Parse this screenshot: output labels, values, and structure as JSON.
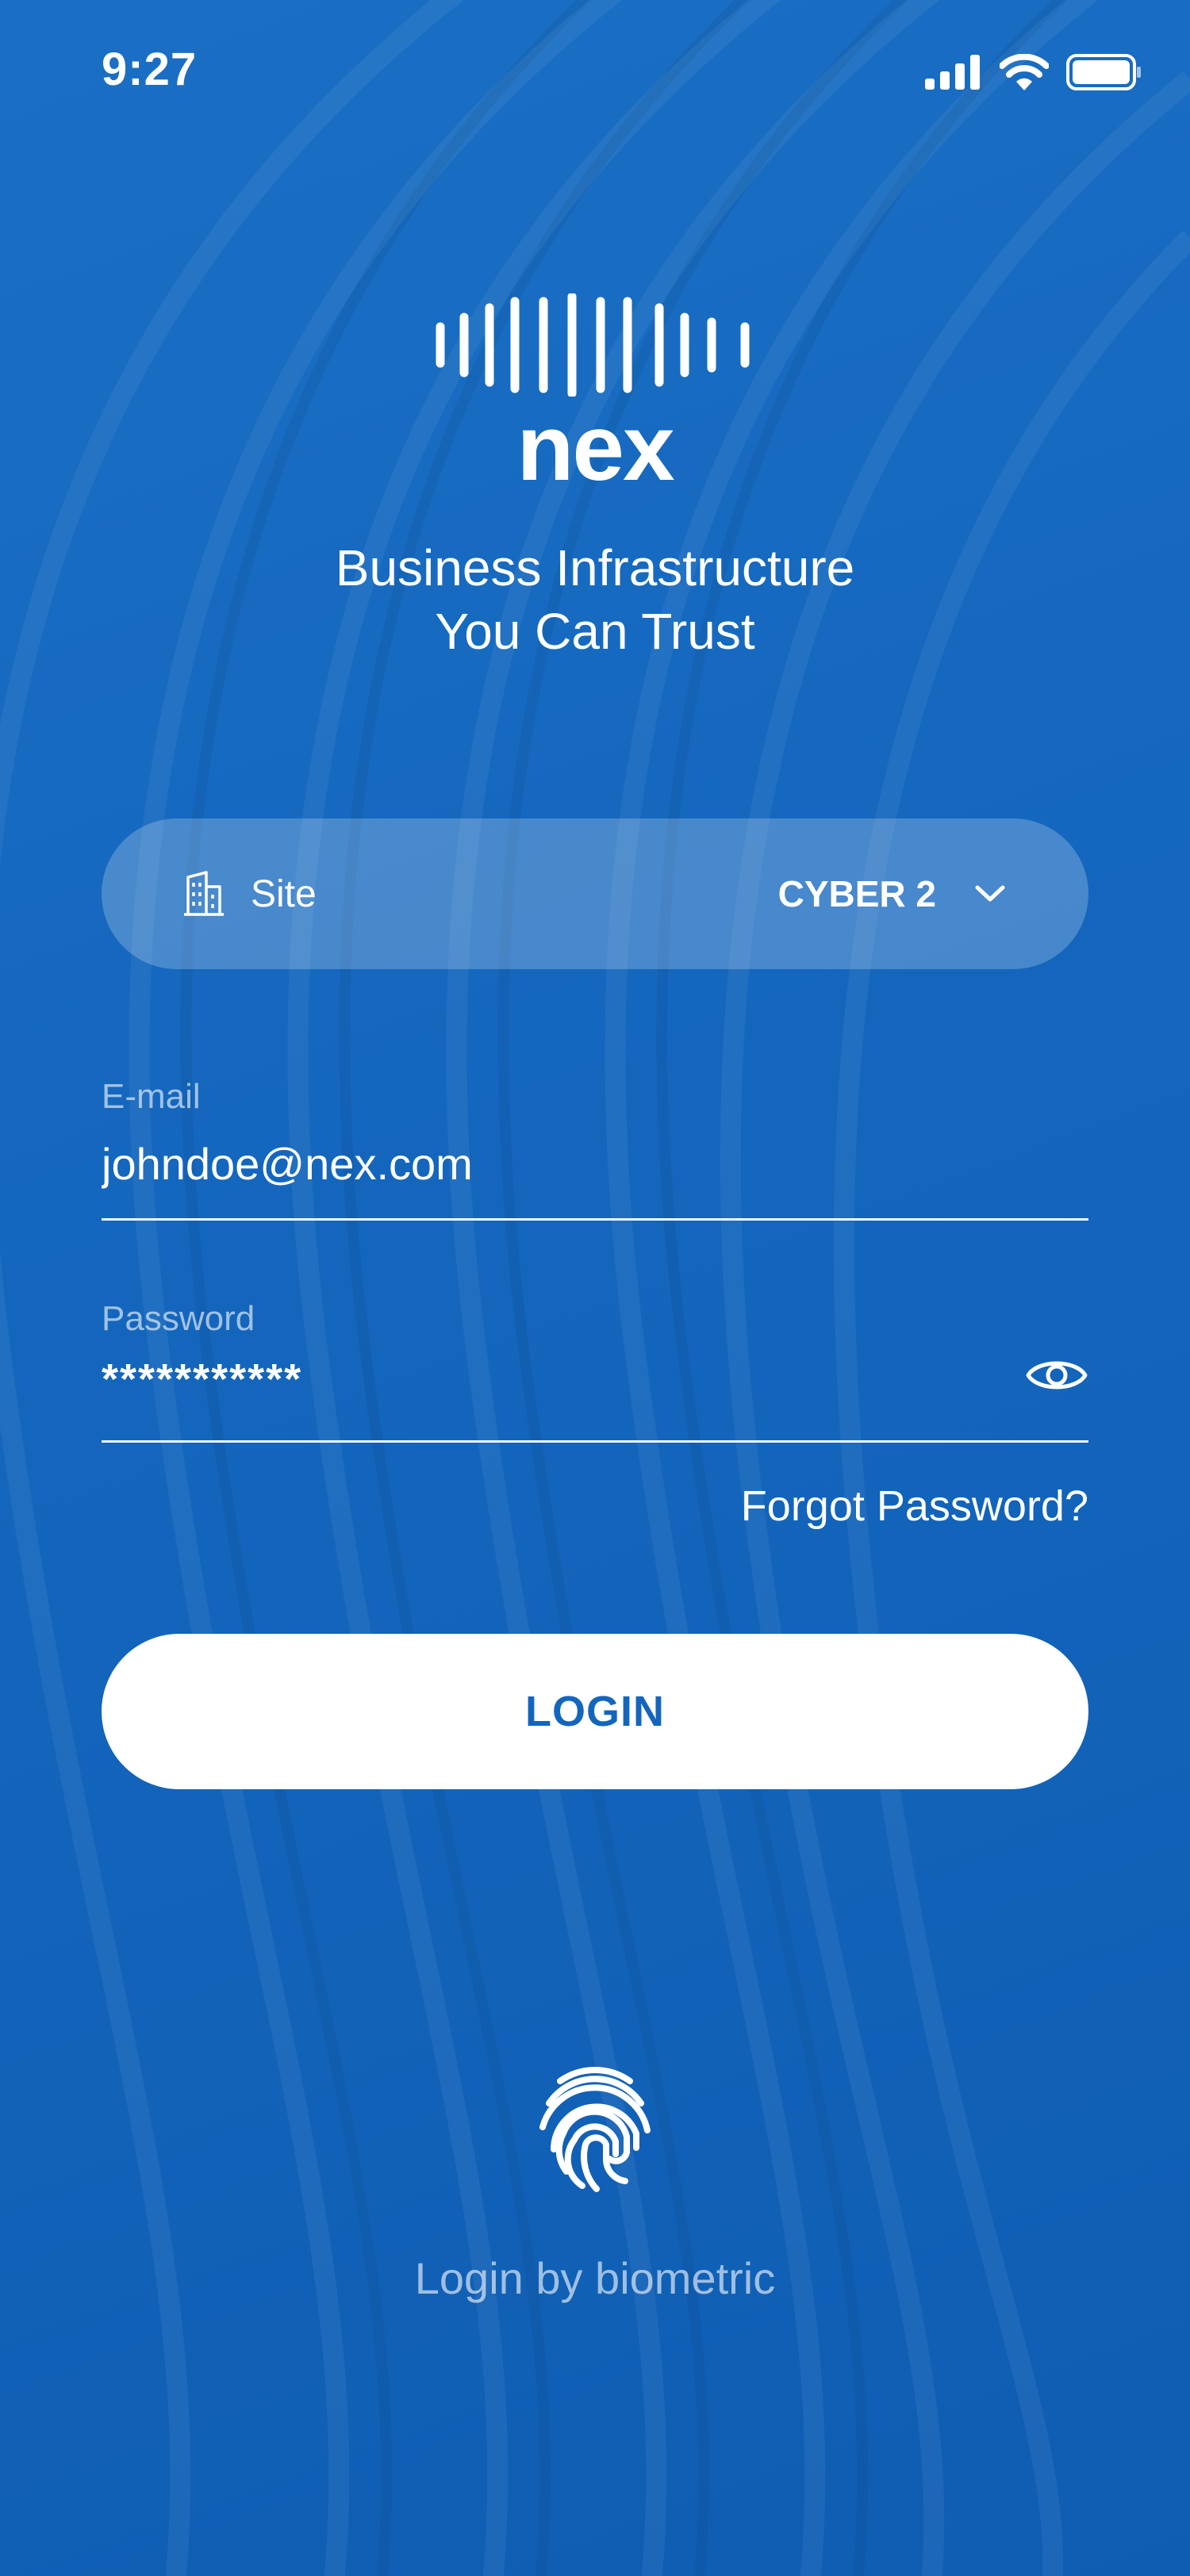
{
  "status_bar": {
    "time": "9:27"
  },
  "brand": {
    "name": "nex",
    "tagline_line1": "Business Infrastructure",
    "tagline_line2": "You Can Trust"
  },
  "site_selector": {
    "label": "Site",
    "value": "CYBER 2",
    "icon": "building-icon"
  },
  "email_field": {
    "label": "E-mail",
    "value": "johndoe@nex.com"
  },
  "password_field": {
    "label": "Password",
    "masked_value": "***********",
    "icon": "eye-icon"
  },
  "links": {
    "forgot_password": "Forgot Password?"
  },
  "buttons": {
    "login": "LOGIN"
  },
  "biometric": {
    "label": "Login by biometric",
    "icon": "fingerprint-icon"
  },
  "colors": {
    "background": "#1466bd",
    "button_text": "#1466bd",
    "button_bg": "#ffffff"
  }
}
